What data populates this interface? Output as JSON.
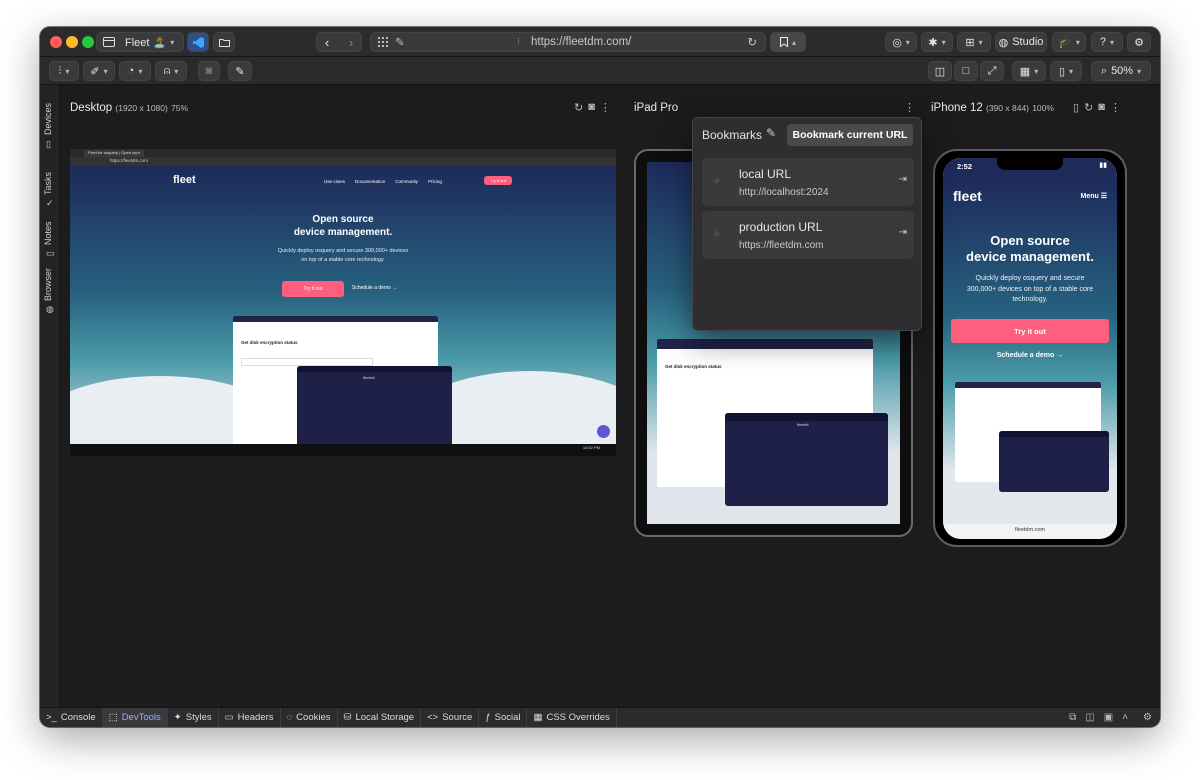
{
  "window": {
    "workspace_label": "Fleet 🏝️",
    "url": "https://fleetdm.com/",
    "studio_label": "Studio",
    "help_label": "?",
    "zoom": "50%"
  },
  "sidebar": {
    "items": [
      "Devices",
      "Tasks",
      "Notes",
      "Browser"
    ]
  },
  "devices": [
    {
      "name": "Desktop",
      "dims": "(1920 x 1080)",
      "scale": "75%"
    },
    {
      "name": "iPad Pro",
      "dims": "",
      "scale": ""
    },
    {
      "name": "iPhone 12",
      "dims": "(390 x 844)",
      "scale": "100%"
    }
  ],
  "bookmarks": {
    "title": "Bookmarks",
    "add_button": "Bookmark current URL",
    "items": [
      {
        "label": "local URL",
        "url": "http://localhost:2024"
      },
      {
        "label": "production URL",
        "url": "https://fleetdm.com"
      }
    ]
  },
  "bottom_tabs": [
    "Console",
    "DevTools",
    "Styles",
    "Headers",
    "Cookies",
    "Local Storage",
    "Source",
    "Social",
    "CSS Overrides"
  ],
  "active_bottom_tab": "DevTools",
  "site": {
    "logo": "fleet",
    "nav": [
      "Use cases",
      "Documentation",
      "Community",
      "Pricing"
    ],
    "try_label": "Try it out",
    "headline_1": "Open source",
    "headline_2": "device management.",
    "sub_1": "Quickly deploy osquery and secure 300,000+ devices",
    "sub_2": "on top of a stable core technology.",
    "phone_sub_1": "Quickly deploy osquery and secure",
    "phone_sub_2": "300,000+ devices on top of a stable core",
    "phone_sub_3": "technology.",
    "demo_label": "Schedule a demo →",
    "dash_title": "Get disk encryption status",
    "menu_label": "Menu ☰",
    "phone_time": "2:52",
    "phone_url": "fleetdm.com",
    "browser_tab": "Fleet for osquery | Open sour",
    "browser_url": "https://fleetdm.com",
    "term_title": "fleetctl",
    "taskbar_time": "14:52 PM"
  },
  "colors": {
    "accent": "#ff5f7e",
    "window_bg": "#1c1c1e",
    "navy": "#1e2a5a"
  }
}
